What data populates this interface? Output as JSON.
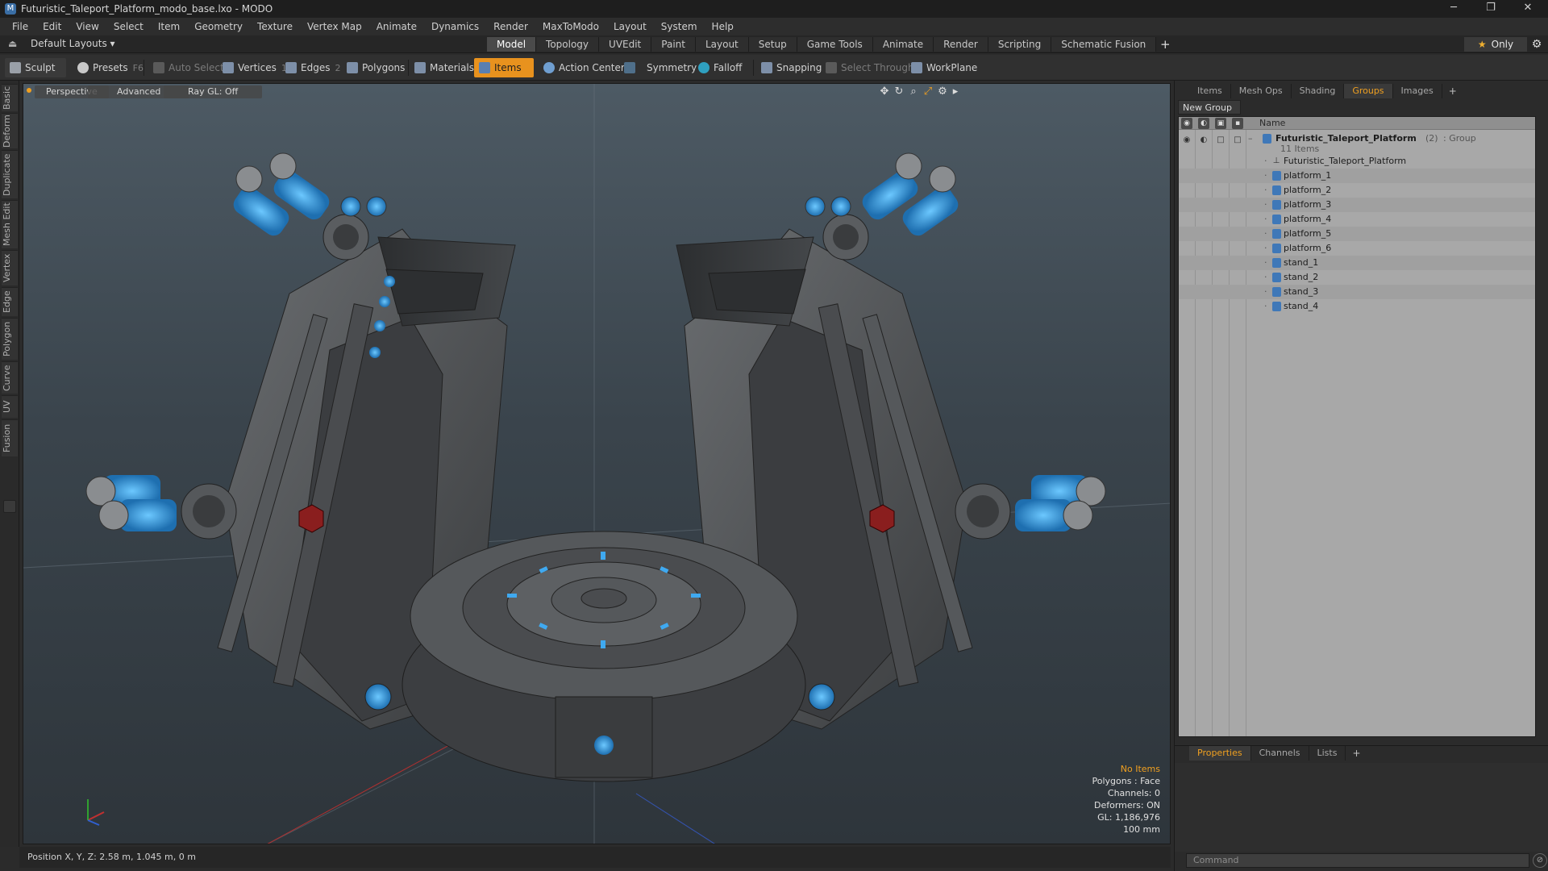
{
  "window": {
    "title": "Futuristic_Taleport_Platform_modo_base.lxo - MODO",
    "app_icon": "M",
    "minimize": "─",
    "maximize": "❐",
    "close": "✕"
  },
  "menu": [
    "File",
    "Edit",
    "View",
    "Select",
    "Item",
    "Geometry",
    "Texture",
    "Vertex Map",
    "Animate",
    "Dynamics",
    "Render",
    "MaxToModo",
    "Layout",
    "System",
    "Help"
  ],
  "layout_selector": "Default Layouts ▾",
  "layout_tabs": [
    "Model",
    "Topology",
    "UVEdit",
    "Paint",
    "Layout",
    "Setup",
    "Game Tools",
    "Animate",
    "Render",
    "Scripting",
    "Schematic Fusion"
  ],
  "layout_tab_add": "+",
  "only_button": "Only",
  "toolbar": {
    "sculpt": "Sculpt",
    "presets": "Presets",
    "presets_key": "F6",
    "auto_select": "Auto Select",
    "vertices": "Vertices",
    "vertices_key": "1",
    "edges": "Edges",
    "edges_key": "2",
    "polygons": "Polygons",
    "materials": "Materials",
    "items": "Items",
    "action_center": "Action Center",
    "symmetry": "Symmetry",
    "falloff": "Falloff",
    "snapping": "Snapping",
    "select_through": "Select Through",
    "workplane": "WorkPlane"
  },
  "left_tabs": [
    "Basic",
    "Deform",
    "Duplicate",
    "Mesh Edit",
    "Vertex",
    "Edge",
    "Polygon",
    "Curve",
    "UV",
    "Fusion"
  ],
  "viewport": {
    "view_mode": "Perspective",
    "shading": "Advanced",
    "raygl": "Ray GL: Off",
    "stats": {
      "no_items": "No Items",
      "polygons": "Polygons : Face",
      "channels": "Channels: 0",
      "deformers": "Deformers: ON",
      "gl": "GL: 1,186,976",
      "scale": "100 mm"
    }
  },
  "status_bar": "Position X, Y, Z:   2.58 m, 1.045 m, 0 m",
  "right_panel": {
    "tabs": [
      "Items",
      "Mesh Ops",
      "Shading",
      "Groups",
      "Images"
    ],
    "active_tab": "Groups",
    "tab_add": "+",
    "new_group": "New Group",
    "name_header": "Name",
    "group": {
      "name": "Futuristic_Taleport_Platform",
      "count": "(2)",
      "type": ": Group",
      "items_count": "11 Items"
    },
    "items": [
      "Futuristic_Taleport_Platform",
      "platform_1",
      "platform_2",
      "platform_3",
      "platform_4",
      "platform_5",
      "platform_6",
      "stand_1",
      "stand_2",
      "stand_3",
      "stand_4"
    ],
    "lower_tabs": [
      "Properties",
      "Channels",
      "Lists"
    ],
    "lower_active": "Properties",
    "command_placeholder": "Command"
  },
  "colors": {
    "accent": "#e8921e",
    "active_tab_text": "#f0a020",
    "item_cube": "#3f78b8"
  }
}
